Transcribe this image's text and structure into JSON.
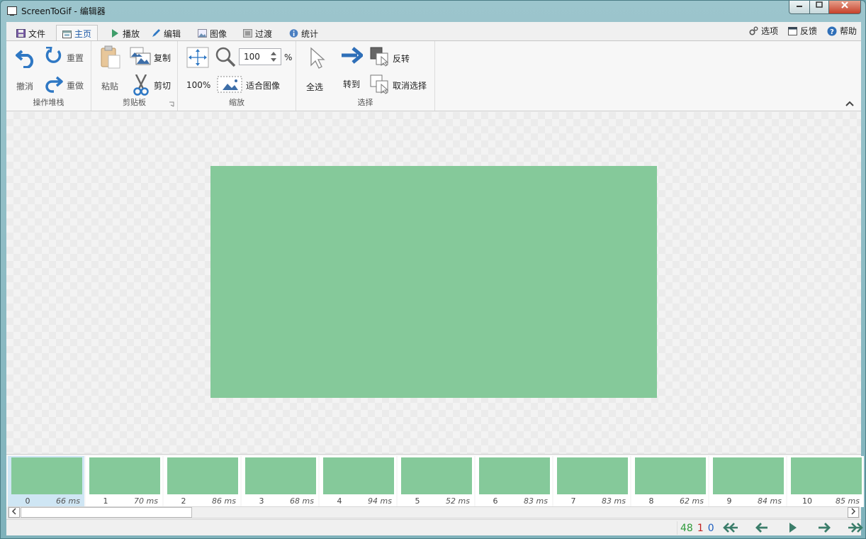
{
  "window": {
    "title": "ScreenToGif - 编辑器"
  },
  "tabs": [
    {
      "label": "文件",
      "icon": "save-icon"
    },
    {
      "label": "主页",
      "icon": "home-icon",
      "active": true
    },
    {
      "label": "播放",
      "icon": "play-icon"
    },
    {
      "label": "编辑",
      "icon": "pencil-icon"
    },
    {
      "label": "图像",
      "icon": "image-icon"
    },
    {
      "label": "过渡",
      "icon": "transition-icon"
    },
    {
      "label": "统计",
      "icon": "info-icon"
    }
  ],
  "right_menu": {
    "options": "选项",
    "feedback": "反馈",
    "help": "帮助"
  },
  "ribbon": {
    "undo_stack": {
      "caption": "操作堆栈",
      "undo": "撤消",
      "redo": "重做",
      "reset": "重置"
    },
    "clipboard": {
      "caption": "剪贴板",
      "paste": "粘贴",
      "copy": "复制",
      "cut": "剪切"
    },
    "zoom": {
      "caption": "缩放",
      "value": "100",
      "percent": "%",
      "zoom100": "100%",
      "fit": "适合图像"
    },
    "select": {
      "caption": "选择",
      "select_all": "全选",
      "goto": "转到",
      "invert": "反转",
      "deselect": "取消选择"
    }
  },
  "colors": {
    "frame": "#85c99a",
    "accent": "#2f78c4",
    "green": "#2e9a3a",
    "red": "#c02020",
    "blue": "#1f5fc0"
  },
  "frames": [
    {
      "index": "0",
      "delay": "66 ms",
      "selected": true
    },
    {
      "index": "1",
      "delay": "70 ms"
    },
    {
      "index": "2",
      "delay": "86 ms"
    },
    {
      "index": "3",
      "delay": "68 ms"
    },
    {
      "index": "4",
      "delay": "94 ms"
    },
    {
      "index": "5",
      "delay": "52 ms"
    },
    {
      "index": "6",
      "delay": "83 ms"
    },
    {
      "index": "7",
      "delay": "83 ms"
    },
    {
      "index": "8",
      "delay": "62 ms"
    },
    {
      "index": "9",
      "delay": "84 ms"
    },
    {
      "index": "10",
      "delay": "85 ms"
    }
  ],
  "status": {
    "total": "48",
    "selected": "1",
    "current": "0"
  }
}
